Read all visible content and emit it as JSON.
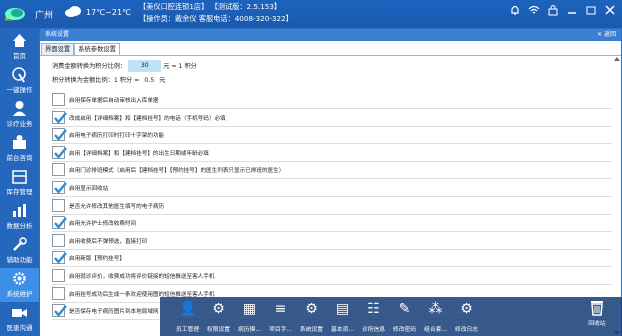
{
  "header": {
    "city": "广州",
    "temperature": "17℃~21℃",
    "store_line": "【美仪口腔连锁1店】",
    "version_line": "【测试版：2.5.153】",
    "operator_line": "【操作员：戴余仪 客服电话：4008-320-322】"
  },
  "sidebar": {
    "items": [
      {
        "label": "首页"
      },
      {
        "label": "一键操作"
      },
      {
        "label": "诊疗业务"
      },
      {
        "label": "前台咨询"
      },
      {
        "label": "库存管理"
      },
      {
        "label": "数据分析"
      },
      {
        "label": "辅助功能"
      },
      {
        "label": "系统维护"
      },
      {
        "label": "医患沟通"
      }
    ],
    "active_index": 7
  },
  "window": {
    "title": "系统设置",
    "back_label": "返回",
    "tabs": [
      "界面设置",
      "系统参数设置"
    ],
    "active_tab": 1
  },
  "settings": {
    "points_label": "消费金额转换为积分比例：",
    "points_value": "30",
    "points_suffix": "元 = 1 积分",
    "points2_label": "积分转换为金额比例：1 积分 =",
    "points2_value": "0.5",
    "points2_suffix": "元",
    "options": [
      {
        "label": "启用保存单据后自动审核出入库单据",
        "checked": false
      },
      {
        "label": "改成启用【详细档案】和【建档挂号】的电话（手机号码）必填",
        "checked": true
      },
      {
        "label": "启用电子病历打印时打印十字架的功能",
        "checked": true
      },
      {
        "label": "启用【详细档案】和【建档挂号】的出生日期或年龄必填",
        "checked": true
      },
      {
        "label": "启用门诊排班模式（启用后【建档挂号】【预约挂号】的医生列表只显示已排班的医生）",
        "checked": false
      },
      {
        "label": "启用显示回收站",
        "checked": true
      },
      {
        "label": "是否允许修改其他医生填写的电子病历",
        "checked": false
      },
      {
        "label": "启用允许护士修改收费时间",
        "checked": true
      },
      {
        "label": "启用收费后不弹预选，直接打印",
        "checked": false
      },
      {
        "label": "启用新版【预约挂号】",
        "checked": true
      },
      {
        "label": "启用就诊评价，收费成功将评价链接的短信推送至客人手机",
        "checked": false
      },
      {
        "label": "启用挂号成功后生成一条欢迎使用图的短信推送至客人手机",
        "checked": false
      },
      {
        "label": "是否保存电子病历图片到本地局域网",
        "checked": true
      }
    ]
  },
  "bottom_bar": {
    "items": [
      "员工管理",
      "权限设置",
      "病历模...",
      "项目字...",
      "系统设置",
      "基本资...",
      "诊所信息",
      "修改密码",
      "组合套...",
      "修改日志"
    ],
    "trash_label": "回收站"
  },
  "colors": {
    "header": "#1b5aad",
    "sidebar": "#2567bd",
    "accent": "#3a7fd2"
  }
}
